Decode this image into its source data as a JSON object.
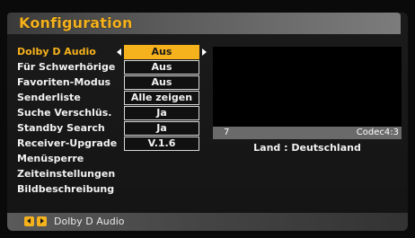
{
  "menu": {
    "title": "Konfiguration",
    "items": [
      {
        "label": "Dolby D Audio",
        "value": "Aus",
        "active": true
      },
      {
        "label": "Für Schwerhörige",
        "value": "Aus"
      },
      {
        "label": "Favoriten-Modus",
        "value": "Aus"
      },
      {
        "label": "Senderliste",
        "value": "Alle zeigen"
      },
      {
        "label": "Suche Verschlüs.",
        "value": "Ja"
      },
      {
        "label": "Standby Search",
        "value": "Ja"
      },
      {
        "label": "Receiver-Upgrade",
        "value": "V.1.6"
      },
      {
        "label": "Menüsperre"
      },
      {
        "label": "Zeiteinstellungen"
      },
      {
        "label": "Bildbeschreibung"
      }
    ]
  },
  "preview": {
    "channel_number": "7",
    "codec": "Codec4:3",
    "country": "Land : Deutschland"
  },
  "footer": {
    "hint": "Dolby D Audio"
  },
  "colors": {
    "accent": "#f6b21c",
    "background": "#0a0a0a",
    "panel": "#1b1b1b"
  }
}
